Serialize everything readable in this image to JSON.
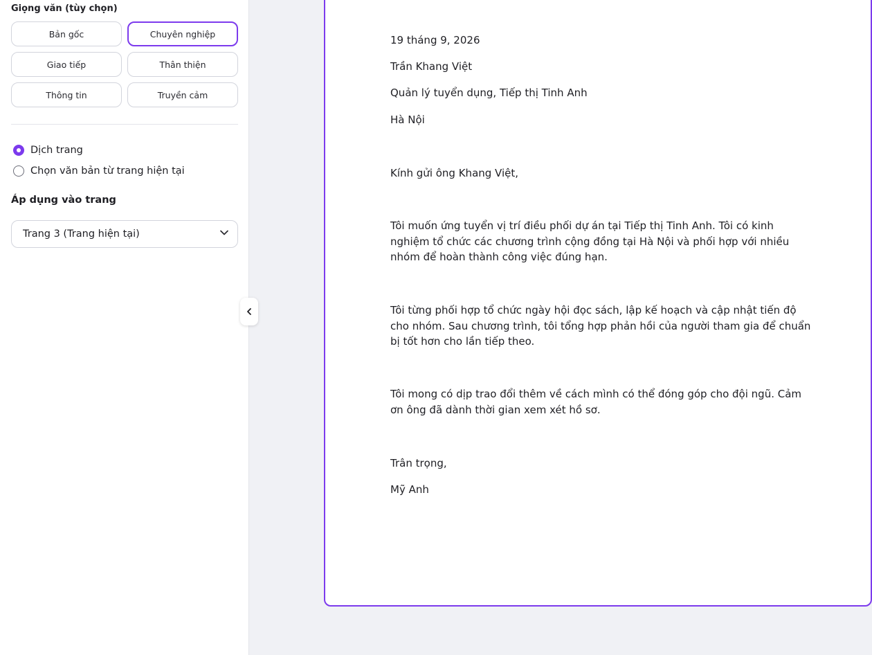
{
  "sidebar": {
    "tone_title": "Giọng văn (tùy chọn)",
    "tones": [
      {
        "label": "Bản gốc",
        "active": false
      },
      {
        "label": "Chuyên nghiệp",
        "active": true
      },
      {
        "label": "Giao tiếp",
        "active": false
      },
      {
        "label": "Thân thiện",
        "active": false
      },
      {
        "label": "Thông tin",
        "active": false
      },
      {
        "label": "Truyền cảm",
        "active": false
      }
    ],
    "modes": [
      {
        "label": "Dịch trang",
        "checked": true
      },
      {
        "label": "Chọn văn bản từ trang hiện tại",
        "checked": false
      }
    ],
    "apply_label": "Áp dụng vào trang",
    "page_select": {
      "value": "Trang 3 (Trang hiện tại)"
    }
  },
  "letter": {
    "date": "19 tháng 9, 2026",
    "recipient_name": "Trần Khang Việt",
    "recipient_title": "Quản lý tuyển dụng, Tiếp thị Tinh Anh",
    "recipient_city": "Hà Nội",
    "salutation": "Kính gửi ông Khang Việt,",
    "paragraphs": [
      "Tôi muốn ứng tuyển vị trí điều phối dự án tại Tiếp thị Tinh Anh. Tôi có kinh nghiệm tổ chức các chương trình cộng đồng tại Hà Nội và phối hợp với nhiều nhóm để hoàn thành công việc đúng hạn.",
      "Tôi từng phối hợp tổ chức ngày hội đọc sách, lập kế hoạch và cập nhật tiến độ cho nhóm. Sau chương trình, tôi tổng hợp phản hồi của người tham gia để chuẩn bị tốt hơn cho lần tiếp theo.",
      "Tôi mong có dịp trao đổi thêm về cách mình có thể đóng góp cho đội ngũ. Cảm ơn ông đã dành thời gian xem xét hồ sơ."
    ],
    "closing": "Trân trọng,",
    "signature": "Mỹ Anh"
  },
  "icons": {
    "dropdown": "chevron-down-icon",
    "collapse": "chevron-left-icon"
  },
  "colors": {
    "accent": "#7c3aed",
    "background": "#f0f1f5"
  }
}
